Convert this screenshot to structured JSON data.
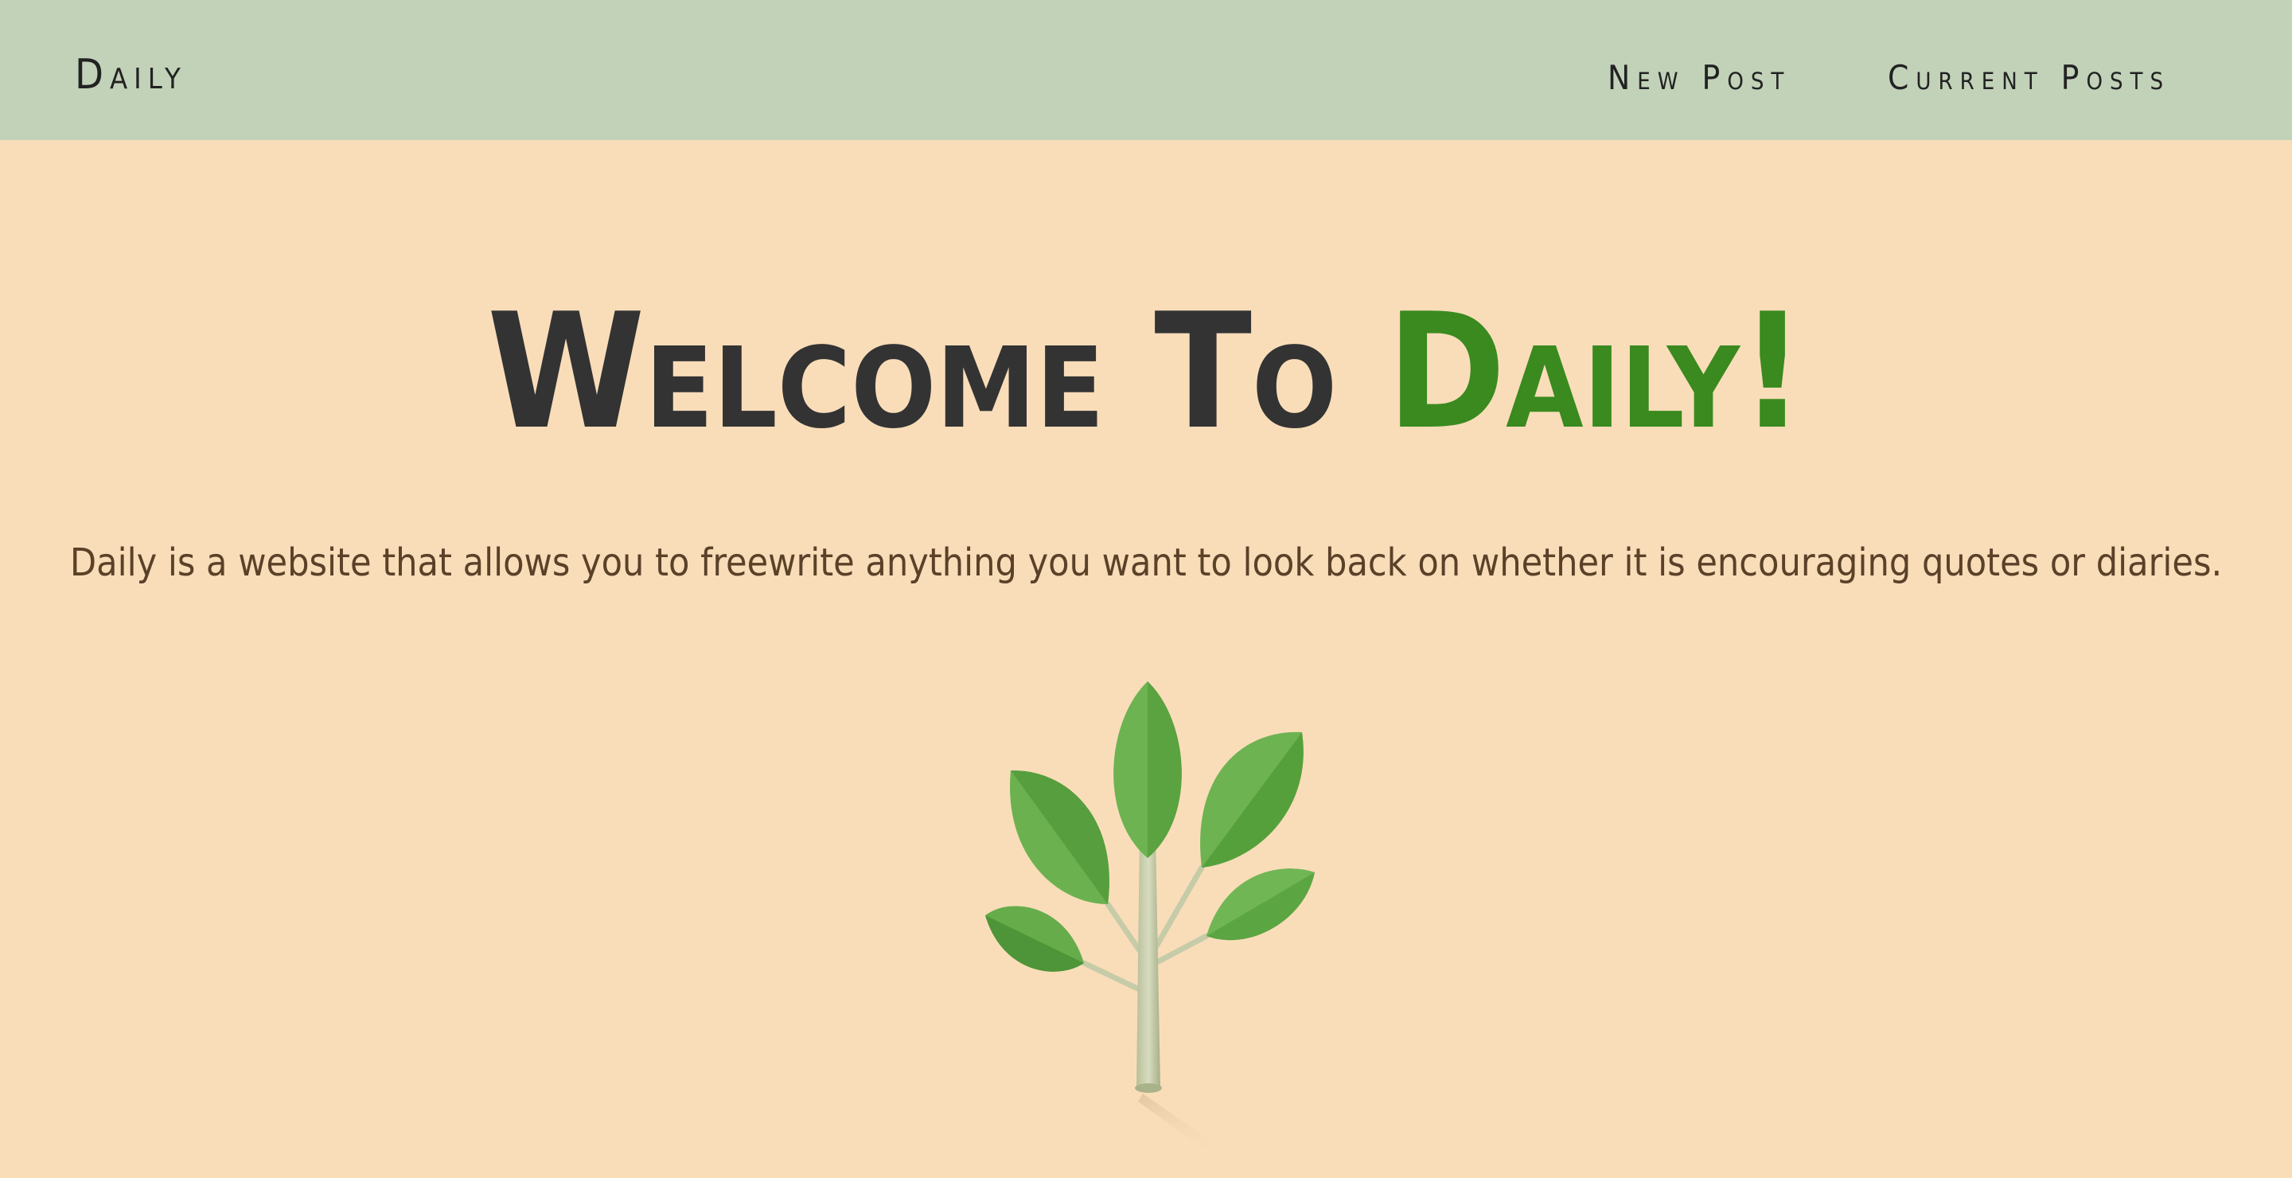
{
  "navbar": {
    "brand": "Daily",
    "links": [
      {
        "label": "New Post"
      },
      {
        "label": "Current Posts"
      }
    ],
    "background": "#c1d2b8"
  },
  "hero": {
    "title_prefix": "Welcome To ",
    "title_accent": "Daily!",
    "subtitle": "Daily is a website that allows you to freewrite anything you want to look back on whether it is encouraging quotes or diaries.",
    "accent_color": "#3a8a1f"
  },
  "illustration": {
    "icon": "plant-sprout-icon"
  },
  "colors": {
    "page_background": "#f9ddb9",
    "text_dark": "#333333",
    "subtitle_brown": "#5a4128"
  }
}
